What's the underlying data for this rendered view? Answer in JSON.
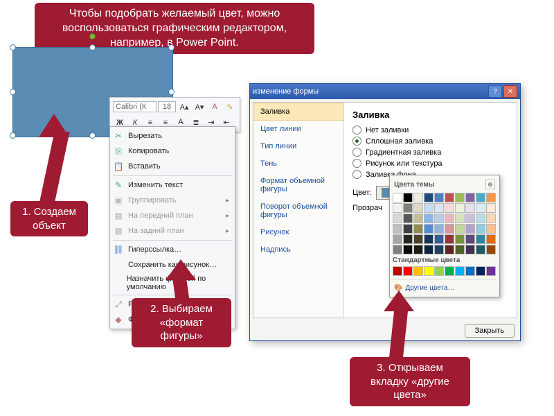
{
  "callouts": {
    "top": "Чтобы подобрать желаемый цвет, можно воспользоваться графическим редактором, например, в Power Point.",
    "step1": "1. Создаем объект",
    "step2": "2. Выбираем «формат фигуры»",
    "step3": "3. Открываем вкладку «другие цвета»"
  },
  "mini_toolbar": {
    "font_name": "Calibri (К",
    "font_size": "18"
  },
  "context_menu": {
    "cut": "Вырезать",
    "copy": "Копировать",
    "paste": "Вставить",
    "edit_text": "Изменить текст",
    "group": "Группировать",
    "bring_front": "На передний план",
    "send_back": "На задний план",
    "hyperlink": "Гиперссылка…",
    "save_as_pic": "Сохранить как рисунок…",
    "set_default": "Назначить фигурой по умолчанию",
    "size_pos": "Размер и положение…",
    "format_shape": "Формат фигуры…"
  },
  "dialog": {
    "title": "изменение формы",
    "nav": {
      "fill": "Заливка",
      "line_color": "Цвет линии",
      "line_type": "Тип линии",
      "shadow": "Тень",
      "three_d": "Формат объемной фигуры",
      "rotation": "Поворот объемной фигуры",
      "picture": "Рисунок",
      "text": "Надпись"
    },
    "main": {
      "heading": "Заливка",
      "no_fill": "Нет заливки",
      "solid": "Сплошная заливка",
      "gradient": "Градиентная заливка",
      "picture": "Рисунок или текстура",
      "background": "Заливка фона",
      "color_label": "Цвет:",
      "opacity_label": "Прозрач"
    },
    "close": "Закрыть"
  },
  "picker": {
    "theme_heading": "Цвета темы",
    "standard_heading": "Стандартные цвета",
    "more_colors": "Другие цвета…",
    "theme_row": [
      "#ffffff",
      "#000000",
      "#eeece1",
      "#1f497d",
      "#4f81bd",
      "#c0504d",
      "#9bbb59",
      "#8064a2",
      "#4bacc6",
      "#f79646"
    ],
    "theme_shades": [
      [
        "#f2f2f2",
        "#7f7f7f",
        "#ddd9c3",
        "#c6d9f0",
        "#dbe5f1",
        "#f2dcdb",
        "#ebf1dd",
        "#e5e0ec",
        "#dbeef3",
        "#fdeada"
      ],
      [
        "#d8d8d8",
        "#595959",
        "#c4bd97",
        "#8db3e2",
        "#b8cce4",
        "#e5b9b7",
        "#d7e3bc",
        "#ccc1d9",
        "#b7dde8",
        "#fbd5b5"
      ],
      [
        "#bfbfbf",
        "#3f3f3f",
        "#938953",
        "#548dd4",
        "#95b3d7",
        "#d99694",
        "#c3d69b",
        "#b2a2c7",
        "#92cddc",
        "#fac08f"
      ],
      [
        "#a5a5a5",
        "#262626",
        "#494429",
        "#17365d",
        "#366092",
        "#953734",
        "#76923c",
        "#5f497a",
        "#31859b",
        "#e36c09"
      ],
      [
        "#7f7f7f",
        "#0c0c0c",
        "#1d1b10",
        "#0f243e",
        "#244061",
        "#632423",
        "#4f6128",
        "#3f3151",
        "#205867",
        "#974806"
      ]
    ],
    "standard_row": [
      "#c00000",
      "#ff0000",
      "#ffc000",
      "#ffff00",
      "#92d050",
      "#00b050",
      "#00b0f0",
      "#0070c0",
      "#002060",
      "#7030a0"
    ]
  }
}
